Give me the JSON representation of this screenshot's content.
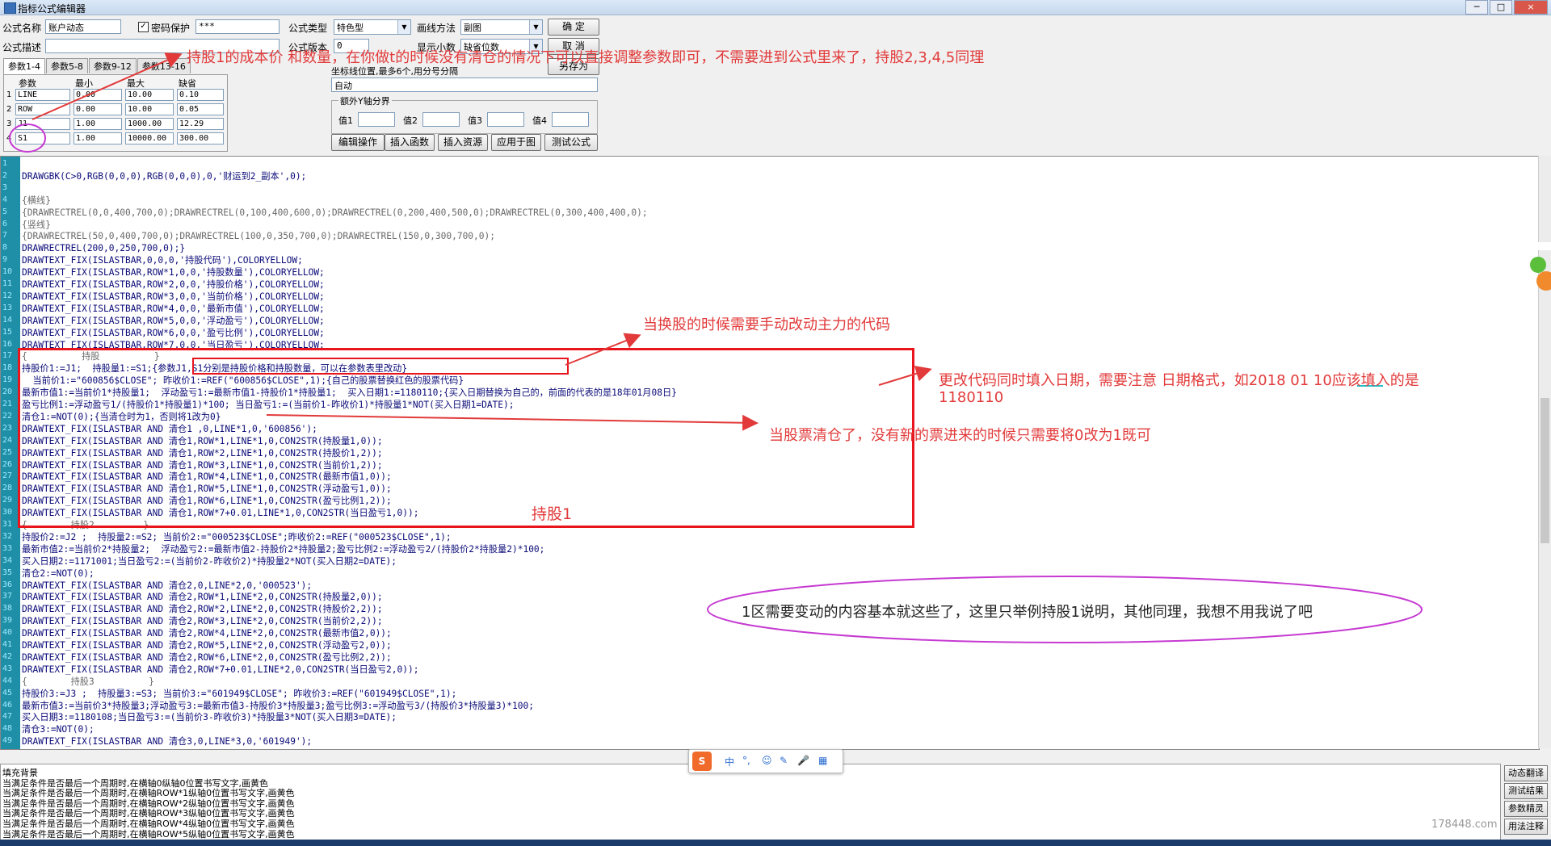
{
  "window": {
    "title": "指标公式编辑器",
    "controls": [
      "─",
      "□",
      "×"
    ]
  },
  "form": {
    "name_label": "公式名称",
    "name_value": "账户动态",
    "password_label": "密码保护",
    "password_checked": "✓",
    "password_value": "***",
    "type_label": "公式类型",
    "type_value": "特色型",
    "draw_label": "画线方法",
    "draw_value": "副图",
    "desc_label": "公式描述",
    "desc_value": "",
    "version_label": "公式版本",
    "version_value": "0",
    "decimal_label": "显示小数",
    "decimal_value": "缺省位数",
    "ok_label": "确  定",
    "cancel_label": "取  消",
    "saveas_label": "另存为",
    "axis_label": "坐标线位置,最多6个,用分号分隔",
    "axis_value": "自动",
    "ybound_group": "额外Y轴分界",
    "ybound_values": [
      "值1",
      "值2",
      "值3",
      "值4"
    ]
  },
  "tabs": [
    "参数1-4",
    "参数5-8",
    "参数9-12",
    "参数13-16"
  ],
  "params": {
    "headers": [
      "参数",
      "最小",
      "最大",
      "缺省"
    ],
    "rows": [
      {
        "n": "1",
        "name": "LINE",
        "min": "0.00",
        "max": "10.00",
        "def": "0.10"
      },
      {
        "n": "2",
        "name": "ROW",
        "min": "0.00",
        "max": "10.00",
        "def": "0.05"
      },
      {
        "n": "3",
        "name": "J1",
        "min": "1.00",
        "max": "1000.00",
        "def": "12.29"
      },
      {
        "n": "4",
        "name": "S1",
        "min": "1.00",
        "max": "10000.00",
        "def": "300.00"
      }
    ]
  },
  "actions": [
    "编辑操作",
    "插入函数",
    "插入资源",
    "应用于图",
    "测试公式"
  ],
  "code_lines": [
    "",
    "DRAWGBK(C>0,RGB(0,0,0),RGB(0,0,0),0,'财运到2_副本',0);",
    "",
    "{横线}",
    "{DRAWRECTREL(0,0,400,700,0);DRAWRECTREL(0,100,400,600,0);DRAWRECTREL(0,200,400,500,0);DRAWRECTREL(0,300,400,400,0);",
    "{竖线}",
    "{DRAWRECTREL(50,0,400,700,0);DRAWRECTREL(100,0,350,700,0);DRAWRECTREL(150,0,300,700,0);",
    "DRAWRECTREL(200,0,250,700,0);}",
    "DRAWTEXT_FIX(ISLASTBAR,0,0,0,'持股代码'),COLORYELLOW;",
    "DRAWTEXT_FIX(ISLASTBAR,ROW*1,0,0,'持股数量'),COLORYELLOW;",
    "DRAWTEXT_FIX(ISLASTBAR,ROW*2,0,0,'持股价格'),COLORYELLOW;",
    "DRAWTEXT_FIX(ISLASTBAR,ROW*3,0,0,'当前价格'),COLORYELLOW;",
    "DRAWTEXT_FIX(ISLASTBAR,ROW*4,0,0,'最新市值'),COLORYELLOW;",
    "DRAWTEXT_FIX(ISLASTBAR,ROW*5,0,0,'浮动盈亏'),COLORYELLOW;",
    "DRAWTEXT_FIX(ISLASTBAR,ROW*6,0,0,'盈亏比例'),COLORYELLOW;",
    "DRAWTEXT_FIX(ISLASTBAR,ROW*7,0,0,'当日盈亏'),COLORYELLOW;",
    "{          持股          }",
    "持股价1:=J1;  持股量1:=S1;{参数J1,S1分别是持股价格和持股数量，可以在参数表里改动}",
    "  当前价1:=\"600856$CLOSE\"; 昨收价1:=REF(\"600856$CLOSE\",1);{自己的股票替换红色的股票代码}",
    "最新市值1:=当前价1*持股量1;  浮动盈亏1:=最新市值1-持股价1*持股量1;  买入日期1:=1180110;{买入日期替换为自己的，前面的代表的是18年01月08日}",
    "盈亏比例1:=浮动盈亏1/(持股价1*持股量1)*100; 当日盈亏1:=(当前价1-昨收价1)*持股量1*NOT(买入日期1=DATE);",
    "清仓1:=NOT(0);{当清仓时为1，否则将1改为0}",
    "DRAWTEXT_FIX(ISLASTBAR AND 清仓1 ,0,LINE*1,0,'600856');",
    "DRAWTEXT_FIX(ISLASTBAR AND 清仓1,ROW*1,LINE*1,0,CON2STR(持股量1,0));",
    "DRAWTEXT_FIX(ISLASTBAR AND 清仓1,ROW*2,LINE*1,0,CON2STR(持股价1,2));",
    "DRAWTEXT_FIX(ISLASTBAR AND 清仓1,ROW*3,LINE*1,0,CON2STR(当前价1,2));",
    "DRAWTEXT_FIX(ISLASTBAR AND 清仓1,ROW*4,LINE*1,0,CON2STR(最新市值1,0));",
    "DRAWTEXT_FIX(ISLASTBAR AND 清仓1,ROW*5,LINE*1,0,CON2STR(浮动盈亏1,0));",
    "DRAWTEXT_FIX(ISLASTBAR AND 清仓1,ROW*6,LINE*1,0,CON2STR(盈亏比例1,2));",
    "DRAWTEXT_FIX(ISLASTBAR AND 清仓1,ROW*7+0.01,LINE*1,0,CON2STR(当日盈亏1,0));",
    "{        持股2         }",
    "持股价2:=J2 ;  持股量2:=S2; 当前价2:=\"000523$CLOSE\";昨收价2:=REF(\"000523$CLOSE\",1);",
    "最新市值2:=当前价2*持股量2;  浮动盈亏2:=最新市值2-持股价2*持股量2;盈亏比例2:=浮动盈亏2/(持股价2*持股量2)*100;",
    "买入日期2:=1171001;当日盈亏2:=(当前价2-昨收价2)*持股量2*NOT(买入日期2=DATE);",
    "清仓2:=NOT(0);",
    "DRAWTEXT_FIX(ISLASTBAR AND 清仓2,0,LINE*2,0,'000523');",
    "DRAWTEXT_FIX(ISLASTBAR AND 清仓2,ROW*1,LINE*2,0,CON2STR(持股量2,0));",
    "DRAWTEXT_FIX(ISLASTBAR AND 清仓2,ROW*2,LINE*2,0,CON2STR(持股价2,2));",
    "DRAWTEXT_FIX(ISLASTBAR AND 清仓2,ROW*3,LINE*2,0,CON2STR(当前价2,2));",
    "DRAWTEXT_FIX(ISLASTBAR AND 清仓2,ROW*4,LINE*2,0,CON2STR(最新市值2,0));",
    "DRAWTEXT_FIX(ISLASTBAR AND 清仓2,ROW*5,LINE*2,0,CON2STR(浮动盈亏2,0));",
    "DRAWTEXT_FIX(ISLASTBAR AND 清仓2,ROW*6,LINE*2,0,CON2STR(盈亏比例2,2));",
    "DRAWTEXT_FIX(ISLASTBAR AND 清仓2,ROW*7+0.01,LINE*2,0,CON2STR(当日盈亏2,0));",
    "{        持股3          }",
    "持股价3:=J3 ;  持股量3:=S3; 当前价3:=\"601949$CLOSE\"; 昨收价3:=REF(\"601949$CLOSE\",1);",
    "最新市值3:=当前价3*持股量3;浮动盈亏3:=最新市值3-持股价3*持股量3;盈亏比例3:=浮动盈亏3/(持股价3*持股量3)*100;",
    "买入日期3:=1180108;当日盈亏3:=(当前价3-昨收价3)*持股量3*NOT(买入日期3=DATE);",
    "清仓3:=NOT(0);",
    "DRAWTEXT_FIX(ISLASTBAR AND 清仓3,0,LINE*3,0,'601949');"
  ],
  "bottom_lines": [
    "填充背景",
    "当满足条件是否最后一个周期时,在横轴0纵轴0位置书写文字,画黄色",
    "当满足条件是否最后一个周期时,在横轴ROW*1纵轴0位置书写文字,画黄色",
    "当满足条件是否最后一个周期时,在横轴ROW*2纵轴0位置书写文字,画黄色",
    "当满足条件是否最后一个周期时,在横轴ROW*3纵轴0位置书写文字,画黄色",
    "当满足条件是否最后一个周期时,在横轴ROW*4纵轴0位置书写文字,画黄色",
    "当满足条件是否最后一个周期时,在横轴ROW*5纵轴0位置书写文字,画黄色"
  ],
  "right_buttons": [
    "动态翻译",
    "测试结果",
    "参数精灵",
    "用法注释"
  ],
  "ime": {
    "logo": "S",
    "items": [
      "中",
      "°,",
      "☺",
      "✎",
      "🎤",
      "▦"
    ]
  },
  "watermark": "178448.com",
  "annotations": {
    "a1": "持股1的成本价 和数量，在你做t的时候没有清仓的情况下可以直接调整参数即可，不需要进到公式里来了，持股2,3,4,5同理",
    "a2": "当换股的时候需要手动改动主力的代码",
    "a3a": "更改代码同时填入日期，需要注意 日期格式，如",
    "a3b": "2018 01 10",
    "a3c": "应该填入的是",
    "a3d": "1180110",
    "a4": "当股票清仓了，没有新的票进来的时候只需要将0改为1既可",
    "a5": "持股1",
    "a6": "1区需要变动的内容基本就这些了，这里只举例持股1说明，其他同理，我想不用我说了吧"
  },
  "colors": {
    "annotation": "#e23a3a",
    "box": "#e8151d",
    "ellipse": "#c63ad2",
    "gutter": "#1e8fa6"
  }
}
